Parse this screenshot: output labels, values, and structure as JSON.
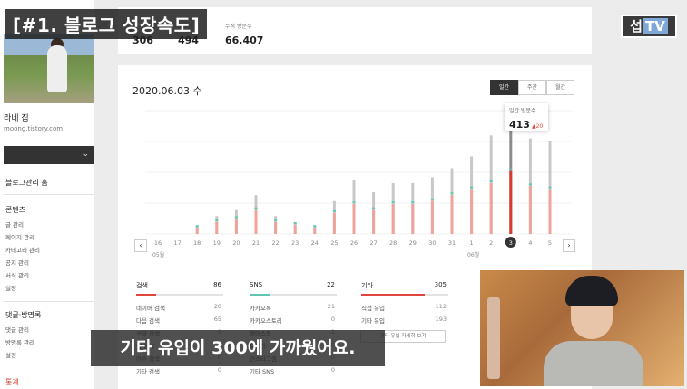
{
  "overlay": {
    "title": "[#1. 블로그 성장속도]",
    "caption": "기타 유입이 300에 가까웠어요.",
    "logo_a": "섭",
    "logo_b": "TV"
  },
  "sidebar": {
    "blog_name": "라네 집",
    "blog_url": "moong.tistory.com",
    "home": "블로그관리 홈",
    "section_content": "콘텐츠",
    "content_items": [
      "글 관리",
      "페이지 관리",
      "카테고리 관리",
      "공지 관리",
      "서식 관리",
      "설정"
    ],
    "section_comments": "댓글·방명록",
    "comment_items": [
      "댓글 관리",
      "방명록 관리",
      "설정"
    ],
    "section_stats": "통계"
  },
  "top_stats": {
    "today": "306",
    "yesterday": "494",
    "total_label": "누적 방문수",
    "total": "66,407"
  },
  "main": {
    "date_title": "2020.06.03 수",
    "tabs": [
      "일간",
      "주간",
      "월간"
    ],
    "tooltip_label": "일간 방문수",
    "tooltip_value": "413",
    "tooltip_delta": "▲20",
    "month_may": "05월",
    "month_june": "06월",
    "detail_button": "기타 유입 자세히 보기"
  },
  "chart_data": {
    "type": "bar",
    "categories": [
      "16",
      "17",
      "18",
      "19",
      "20",
      "21",
      "22",
      "23",
      "24",
      "25",
      "26",
      "27",
      "28",
      "29",
      "30",
      "31",
      "1",
      "2",
      "3",
      "4",
      "5"
    ],
    "highlight_index": 18,
    "series": [
      {
        "values": [
          0,
          0,
          30,
          60,
          80,
          130,
          60,
          40,
          30,
          110,
          180,
          140,
          170,
          170,
          190,
          220,
          260,
          330,
          413,
          320,
          310
        ]
      },
      {
        "values": [
          0,
          0,
          20,
          40,
          50,
          80,
          40,
          30,
          20,
          70,
          100,
          80,
          100,
          100,
          110,
          130,
          150,
          170,
          210,
          160,
          150
        ]
      }
    ],
    "colors": {
      "total": "#c8c8c8",
      "sub": "#f0a39a",
      "highlight": "#d63b2f",
      "accent": "#5fc7b0"
    }
  },
  "tables": [
    {
      "head": "검색",
      "total": "86",
      "rows": [
        [
          "네이버 검색",
          "20"
        ],
        [
          "다음 검색",
          "65"
        ],
        [
          "구글 검색",
          "1"
        ],
        [
          "줌 검색",
          "0"
        ],
        [
          "야후 검색",
          "0"
        ],
        [
          "기타 검색",
          "0"
        ]
      ]
    },
    {
      "head": "SNS",
      "total": "22",
      "rows": [
        [
          "카카오톡",
          "21"
        ],
        [
          "카카오스토리",
          "0"
        ],
        [
          "페이스북",
          "1"
        ],
        [
          "트위터",
          "0"
        ],
        [
          "인스타그램",
          "0"
        ],
        [
          "기타 SNS",
          "0"
        ]
      ]
    },
    {
      "head": "기타",
      "total": "305",
      "rows": [
        [
          "직접 유입",
          "112"
        ],
        [
          "기타 유입",
          "193"
        ]
      ]
    }
  ]
}
